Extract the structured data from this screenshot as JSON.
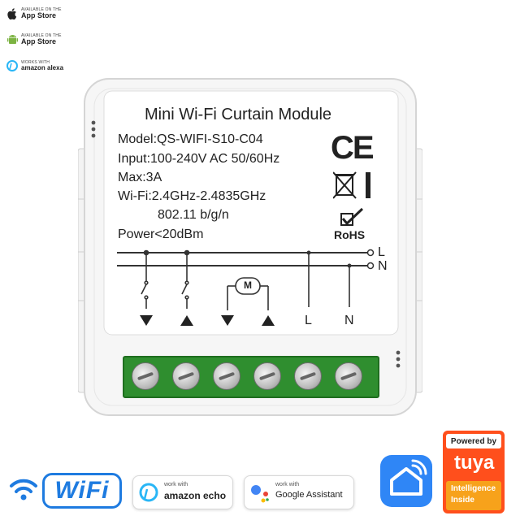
{
  "badges": {
    "appstore1": {
      "small": "AVAILABLE ON THE",
      "big": "App Store",
      "icon": "apple-icon"
    },
    "appstore2": {
      "small": "AVAILABLE ON THE",
      "big": "App Store",
      "icon": "android-icon"
    },
    "alexa": {
      "small": "WORKS WITH",
      "big": "amazon alexa",
      "icon": "alexa-icon"
    }
  },
  "module": {
    "title": "Mini Wi-Fi Curtain Module",
    "model": "Model:QS-WIFI-S10-C04",
    "input": "Input:100-240V AC  50/60Hz",
    "max": "Max:3A",
    "wifi": "Wi-Fi:2.4GHz-2.4835GHz",
    "standard": "802.11 b/g/n",
    "power": "Power<20dBm",
    "ce": "CE",
    "rohs": "RoHS",
    "line_l": "L",
    "line_n": "N",
    "motor": "M",
    "term_l": "L",
    "term_n": "N"
  },
  "logos": {
    "wifi": "WiFi",
    "echo_small": "work with",
    "echo_big": "amazon echo",
    "google_small": "work with",
    "google_big": "Google Assistant",
    "tuya_powered": "Powered by",
    "tuya_brand": "tuya",
    "tuya_sub1": "Intelligence",
    "tuya_sub2": "Inside"
  },
  "colors": {
    "terminal_green": "#2f8e2f",
    "wifi_blue": "#1e7be0",
    "tuya_orange": "#ff4f1c",
    "smart_home_blue": "#2f86f6"
  }
}
